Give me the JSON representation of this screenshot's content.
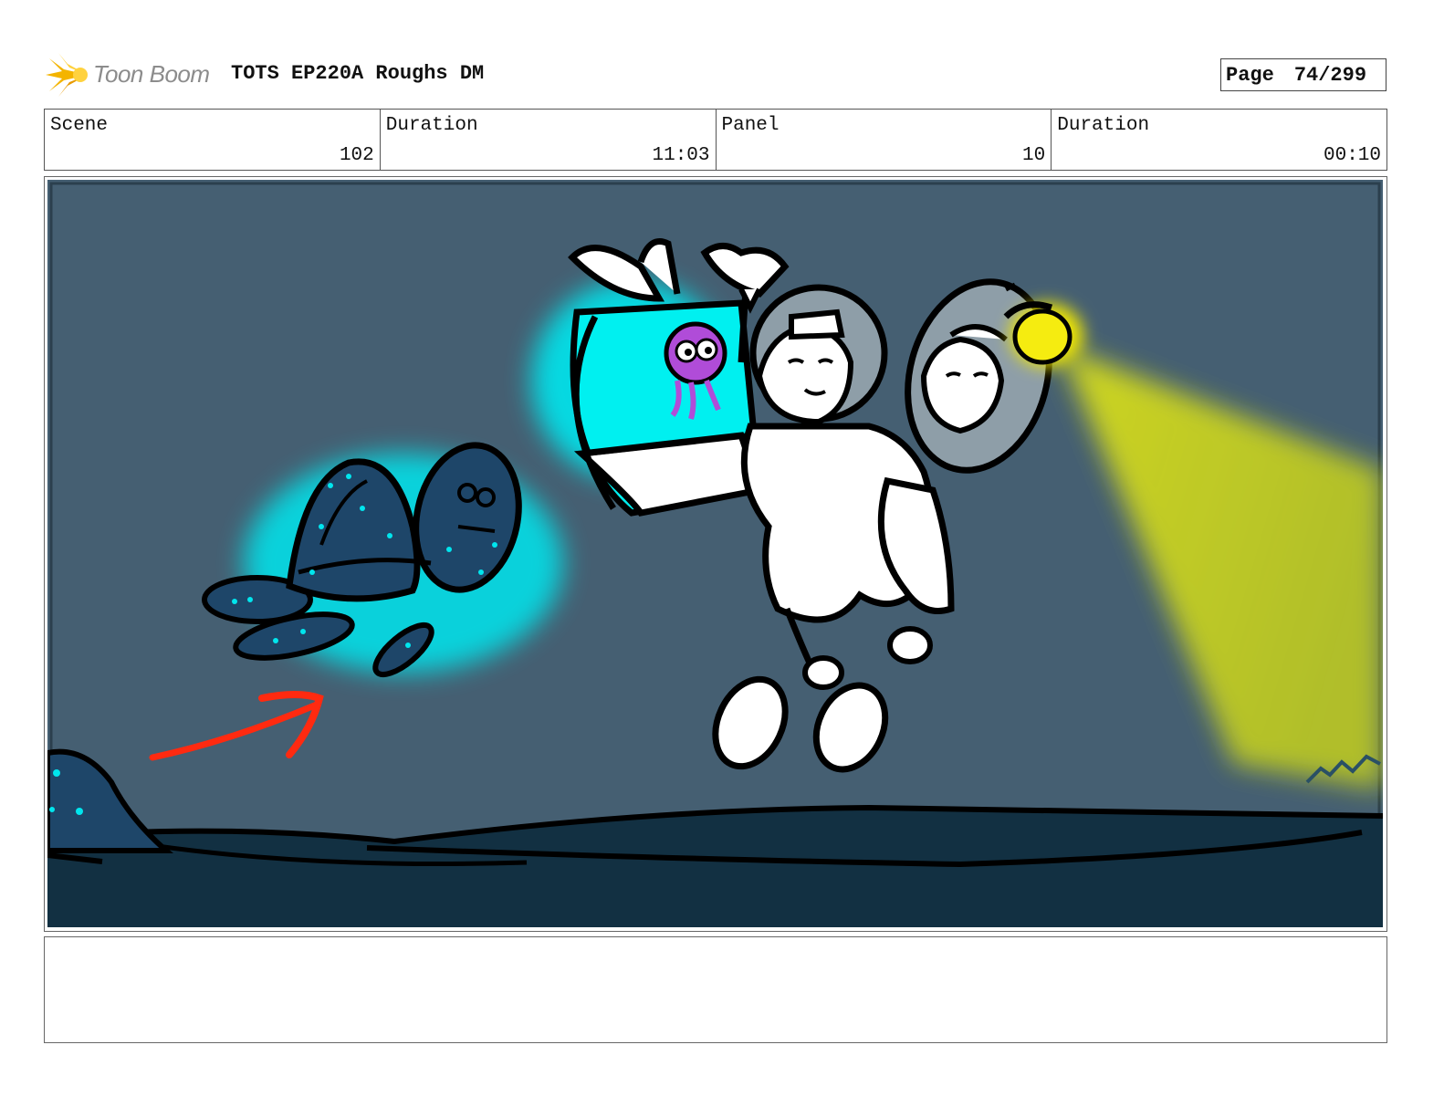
{
  "header": {
    "logo_text": "Toon Boom",
    "title": "TOTS EP220A Roughs DM",
    "page_label": "Page",
    "page_value": "74/299"
  },
  "info": {
    "scene_label": "Scene",
    "scene_value": "102",
    "scene_duration_label": "Duration",
    "scene_duration_value": "11:03",
    "panel_label": "Panel",
    "panel_value": "10",
    "panel_duration_label": "Duration",
    "panel_duration_value": "00:10"
  },
  "colors": {
    "water": "#455f72",
    "seafloor": "#123042",
    "glow": "#00f0f0",
    "light_beam": "#c9d41c",
    "arrow": "#ff2a10",
    "octopus": "#b04cd8"
  },
  "icons": {
    "logo": "toon-boom-starburst-icon"
  },
  "notes": {
    "text": ""
  }
}
